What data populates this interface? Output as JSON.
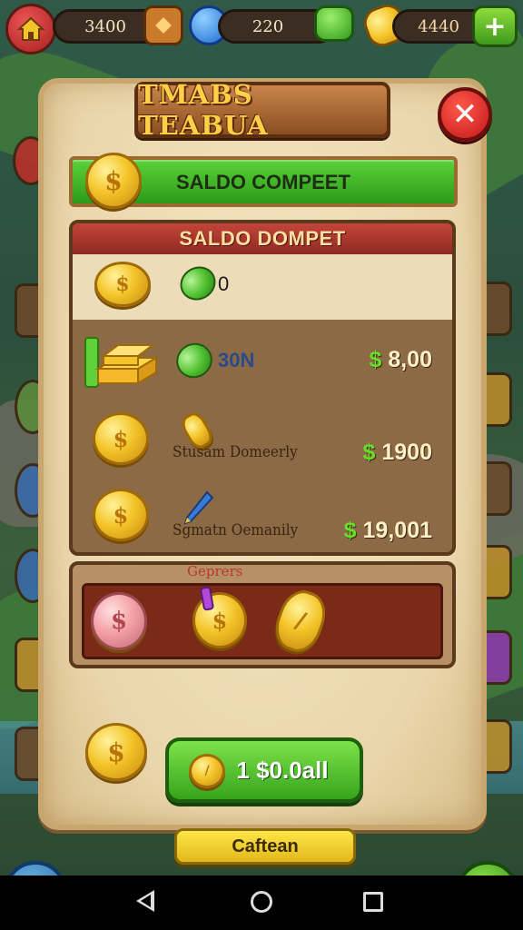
{
  "header": {
    "home_icon": "house-icon",
    "resources": [
      {
        "value": "3400",
        "icon": "amber-gem-icon"
      },
      {
        "value": "220",
        "icon": "blue-gem-icon",
        "icon_end": "cash-stack-icon"
      },
      {
        "value": "4440",
        "icon": "gold-coin-icon"
      }
    ],
    "plus_label": "+"
  },
  "dialog": {
    "title": "TMABS TEABUA",
    "close_label": "✕",
    "wallet_bar_label": "SALDO COMPEET",
    "shop": {
      "header": "SALDO DOMPET",
      "balance_amount": "0",
      "offers": [
        {
          "amount": "30N",
          "name": "",
          "price": "8,00",
          "currency": "$",
          "icon": "gold-bar-stack-icon"
        },
        {
          "amount": "",
          "name": "Stusam Domeerly",
          "price": "1900",
          "currency": "$",
          "icon": "gold-coin-icon"
        },
        {
          "amount": "",
          "name": "Sgmatn Oemanily",
          "price": "19,001",
          "currency": "$",
          "icon": "gold-coin-icon"
        }
      ]
    },
    "specials": {
      "label": "Geprers",
      "items": [
        {
          "icon": "pink-coin-icon"
        },
        {
          "icon": "sparkle-coin-icon"
        },
        {
          "icon": "gold-coin-icon"
        }
      ]
    },
    "buy_button": "1 $0.0all",
    "confirm_button": "Caftean"
  },
  "colors": {
    "accent_green": "#3fb51f",
    "title_gold": "#ffcf48",
    "close_red": "#d0201c",
    "parchment": "#ead6ab"
  }
}
